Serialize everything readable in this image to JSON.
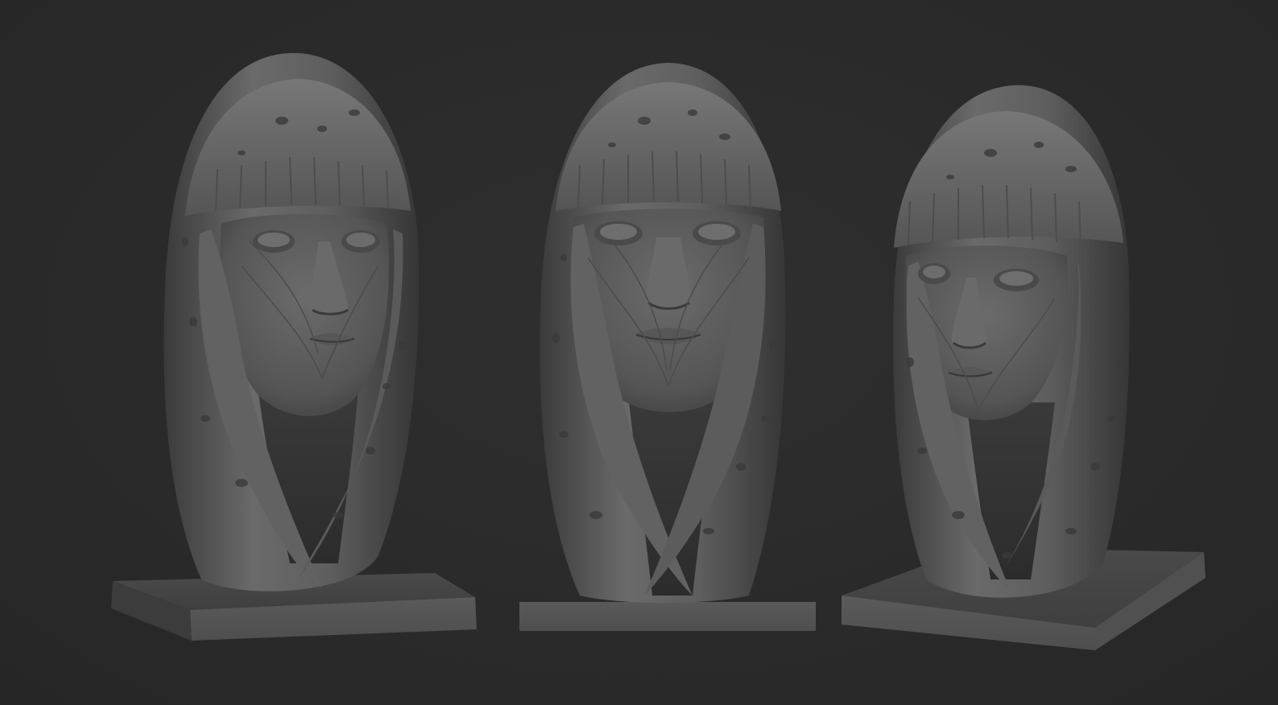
{
  "scene": {
    "background_color": "#2b2b2b",
    "material_color": "#5c5c5c",
    "views": [
      {
        "name": "bust-three-quarter-left",
        "turn": -0.35
      },
      {
        "name": "bust-front",
        "turn": 0.0
      },
      {
        "name": "bust-three-quarter-right",
        "turn": 0.45
      }
    ]
  }
}
